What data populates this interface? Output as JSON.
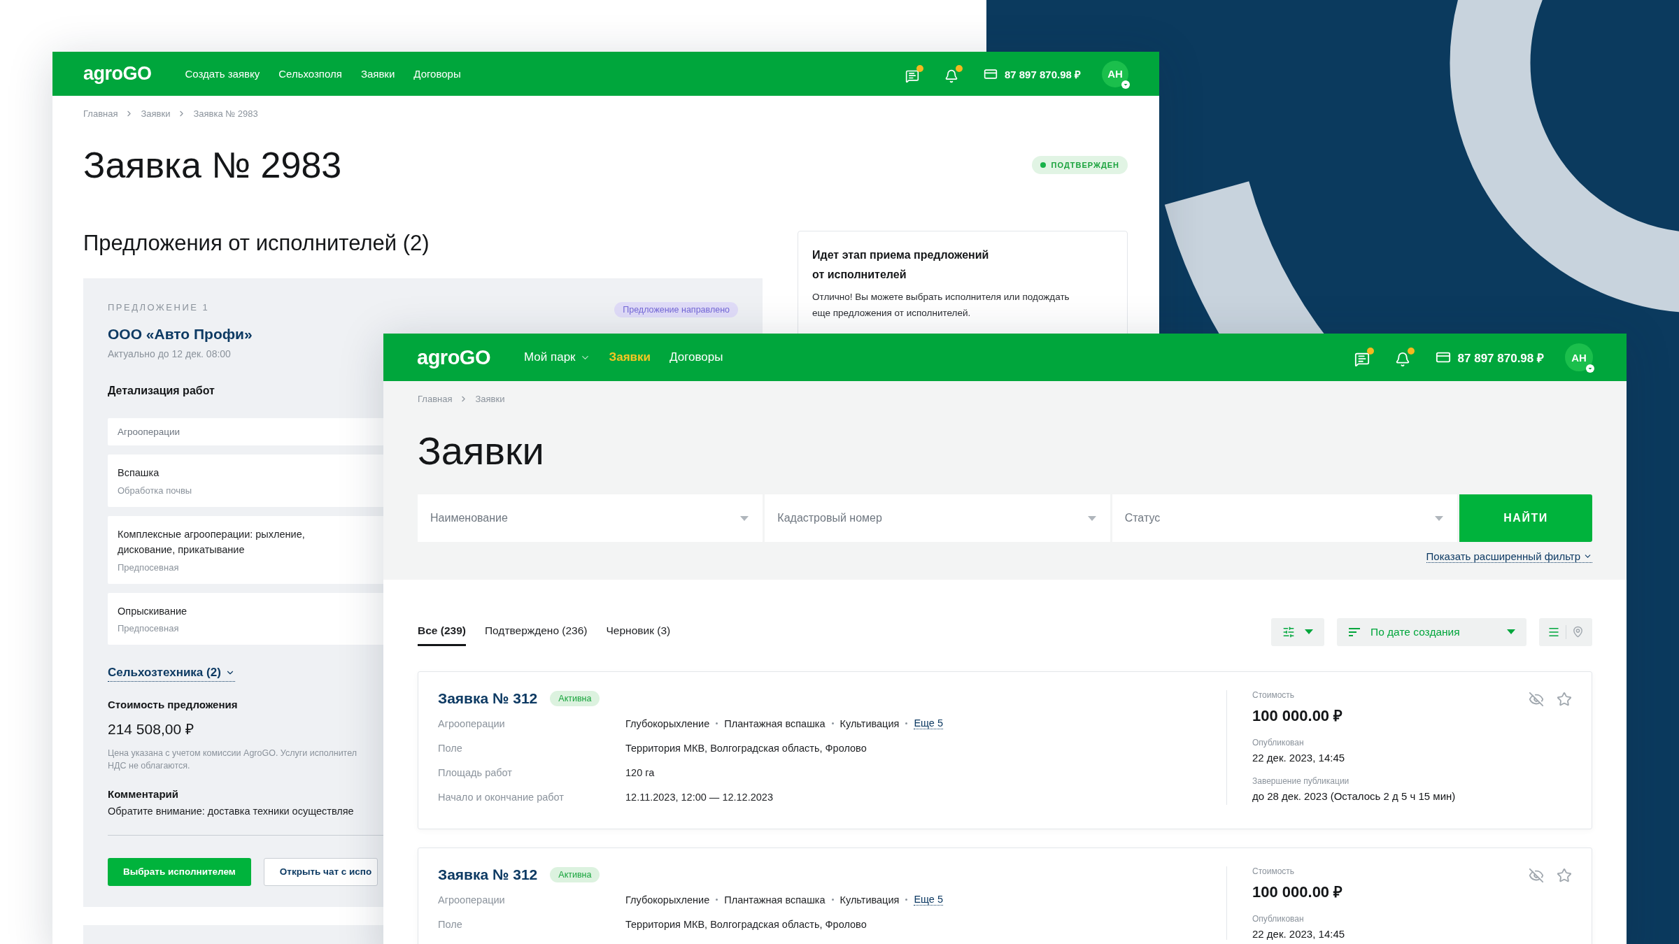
{
  "back_window": {
    "header": {
      "logo": "agroGO",
      "nav": [
        {
          "label": "Создать заявку",
          "selected": false
        },
        {
          "label": "Сельхозполя",
          "selected": false
        },
        {
          "label": "Заявки",
          "selected": false
        },
        {
          "label": "Договоры",
          "selected": false
        }
      ],
      "balance": "87 897 870.98 ₽",
      "avatar": "АН"
    },
    "breadcrumbs": [
      "Главная",
      "Заявки",
      "Заявка № 2983"
    ],
    "title": "Заявка № 2983",
    "status_badge": "ПОДТВЕРЖДЕН",
    "offers_title": "Предложения от исполнителей (2)",
    "offer": {
      "label": "ПРЕДЛОЖЕНИЕ 1",
      "badge": "Предложение направлено",
      "company": "ООО «Авто Профи»",
      "valid_until": "Актуально до 12 дек. 08:00",
      "details_title": "Детализация работ",
      "details_header": "Агрооперации",
      "details": [
        {
          "name": "Вспашка",
          "category": "Обработка почвы"
        },
        {
          "name": "Комплексные агрооперации: рыхление, дискование, прикатывание",
          "category": "Предпосевная"
        },
        {
          "name": "Опрыскивание",
          "category": "Предпосевная"
        }
      ],
      "machinery_link": "Сельхозтехника (2)",
      "price_label": "Стоимость предложения",
      "price": "214 508,00 ₽",
      "price_note": [
        "Цена указана с учетом комиссии AgroGO. Услуги исполнител",
        "НДС не облагаются."
      ],
      "comment_label": "Комментарий",
      "comment": "Обратите внимание: доставка техники осуществляе",
      "buttons": [
        {
          "label": "Выбрать исполнителем",
          "kind": "primary"
        },
        {
          "label": "Открыть чат с испо",
          "kind": "outline"
        }
      ]
    },
    "info_card": {
      "title": [
        "Идет этап приема предложений",
        "от исполнителей"
      ],
      "text": [
        "Отлично! Вы можете выбрать исполнителя или подождать",
        "еще предложения от исполнителей."
      ]
    }
  },
  "front_window": {
    "header": {
      "logo": "agroGO",
      "nav": [
        {
          "label": "Мой парк",
          "selected": false,
          "has_dropdown": true
        },
        {
          "label": "Заявки",
          "selected": true,
          "has_dropdown": false
        },
        {
          "label": "Договоры",
          "selected": false,
          "has_dropdown": false
        }
      ],
      "balance": "87 897 870.98 ₽",
      "avatar": "АН"
    },
    "breadcrumbs": [
      "Главная",
      "Заявки"
    ],
    "title": "Заявки",
    "filters": [
      {
        "placeholder": "Наименование"
      },
      {
        "placeholder": "Кадастровый номер"
      },
      {
        "placeholder": "Статус"
      }
    ],
    "search_button": "НАЙТИ",
    "advanced_filter_link": "Показать расширенный фильтр",
    "tabs": [
      {
        "label": "Все (239)",
        "selected": true
      },
      {
        "label": "Подтверждено (236)",
        "selected": false
      },
      {
        "label": "Черновик (3)",
        "selected": false
      }
    ],
    "sort_label": "По дате создания",
    "views": [
      {
        "kind": "list",
        "selected": true
      },
      {
        "kind": "map",
        "selected": false
      }
    ],
    "requests": [
      {
        "title": "Заявка № 312",
        "status": "Активна",
        "operations": [
          "Глубокорыхление",
          "Плантажная вспашка",
          "Культивация"
        ],
        "more": "Еще 5",
        "fields": [
          {
            "label": "Агрооперации"
          },
          {
            "label": "Поле",
            "value": "Территория МКВ, Волгоградская область, Фролово"
          },
          {
            "label": "Площадь работ",
            "value": "120 га"
          },
          {
            "label": "Начало и окончание работ",
            "value": "12.11.2023, 12:00 — 12.12.2023"
          }
        ],
        "meta": [
          {
            "label": "Стоимость",
            "value": "100 000.00 ₽",
            "kind": "price"
          },
          {
            "label": "Опубликован",
            "value": "22 дек. 2023, 14:45",
            "kind": "text"
          },
          {
            "label": "Завершение публикации",
            "value": "до 28 дек. 2023 (Осталось 2 д 5 ч 15 мин)",
            "kind": "text"
          }
        ]
      },
      {
        "title": "Заявка № 312",
        "status": "Активна",
        "operations": [
          "Глубокорыхление",
          "Плантажная вспашка",
          "Культивация"
        ],
        "more": "Еще 5",
        "fields": [
          {
            "label": "Агрооперации"
          },
          {
            "label": "Поле",
            "value": "Территория МКВ, Волгоградская область, Фролово"
          }
        ],
        "meta": [
          {
            "label": "Стоимость",
            "value": "100 000.00 ₽",
            "kind": "price"
          },
          {
            "label": "Опубликован",
            "value": "22 дек. 2023, 14:45",
            "kind": "text"
          }
        ]
      }
    ]
  }
}
